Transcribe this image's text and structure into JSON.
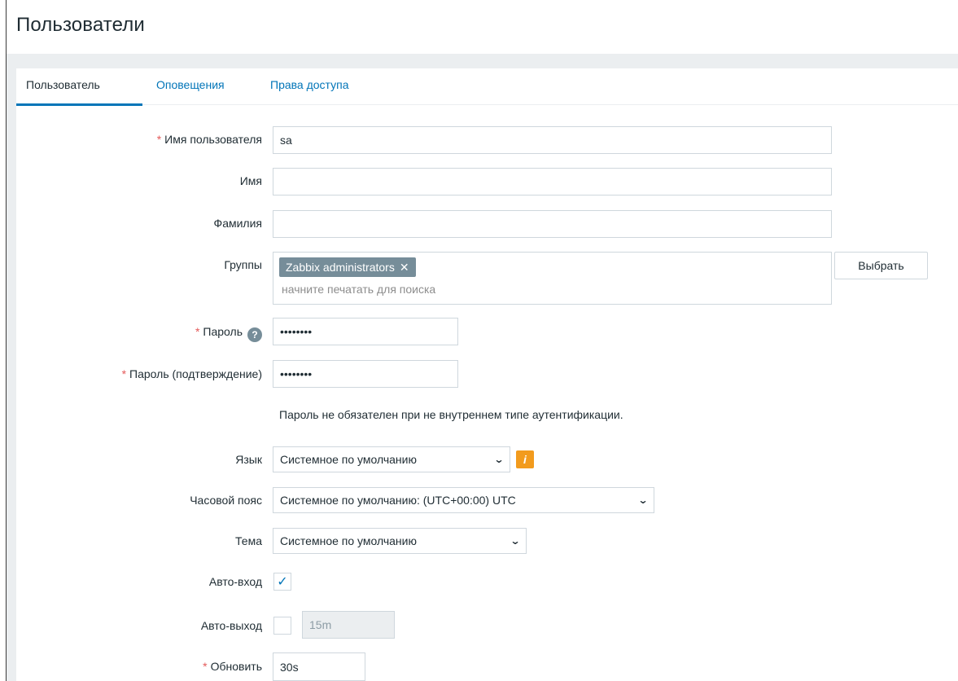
{
  "page": {
    "title": "Пользователи"
  },
  "tabs": [
    {
      "label": "Пользователь",
      "active": true
    },
    {
      "label": "Оповещения",
      "active": false
    },
    {
      "label": "Права доступа",
      "active": false
    }
  ],
  "form": {
    "username": {
      "label": "Имя пользователя",
      "value": "sa",
      "required": true
    },
    "name": {
      "label": "Имя",
      "value": ""
    },
    "surname": {
      "label": "Фамилия",
      "value": ""
    },
    "groups": {
      "label": "Группы",
      "selected": [
        "Zabbix administrators"
      ],
      "remove_glyph": "✕",
      "placeholder": "начните печатать для поиска",
      "select_button": "Выбрать"
    },
    "password": {
      "label": "Пароль",
      "value": "••••••••",
      "required": true,
      "help_glyph": "?"
    },
    "password_confirm": {
      "label": "Пароль (подтверждение)",
      "value": "••••••••",
      "required": true
    },
    "password_note": "Пароль не обязателен при не внутреннем типе аутентификации.",
    "language": {
      "label": "Язык",
      "value": "Системное по умолчанию",
      "info_glyph": "i"
    },
    "timezone": {
      "label": "Часовой пояс",
      "value": "Системное по умолчанию: (UTC+00:00) UTC"
    },
    "theme": {
      "label": "Тема",
      "value": "Системное по умолчанию"
    },
    "autologin": {
      "label": "Авто-вход",
      "checked": true,
      "check_glyph": "✓"
    },
    "autologout": {
      "label": "Авто-выход",
      "checked": false,
      "value": "15m"
    },
    "refresh": {
      "label": "Обновить",
      "value": "30s",
      "required": true
    }
  },
  "required_marker": "*",
  "colors": {
    "link": "#0275b8",
    "required": "#e45959",
    "tag_bg": "#768d99",
    "warning": "#f29b1d",
    "band": "#ebeef0"
  },
  "icons": {
    "help": "help-icon",
    "info": "info-icon",
    "remove": "close-icon",
    "dropdown": "chevron-down-icon",
    "check": "checkmark-icon"
  }
}
